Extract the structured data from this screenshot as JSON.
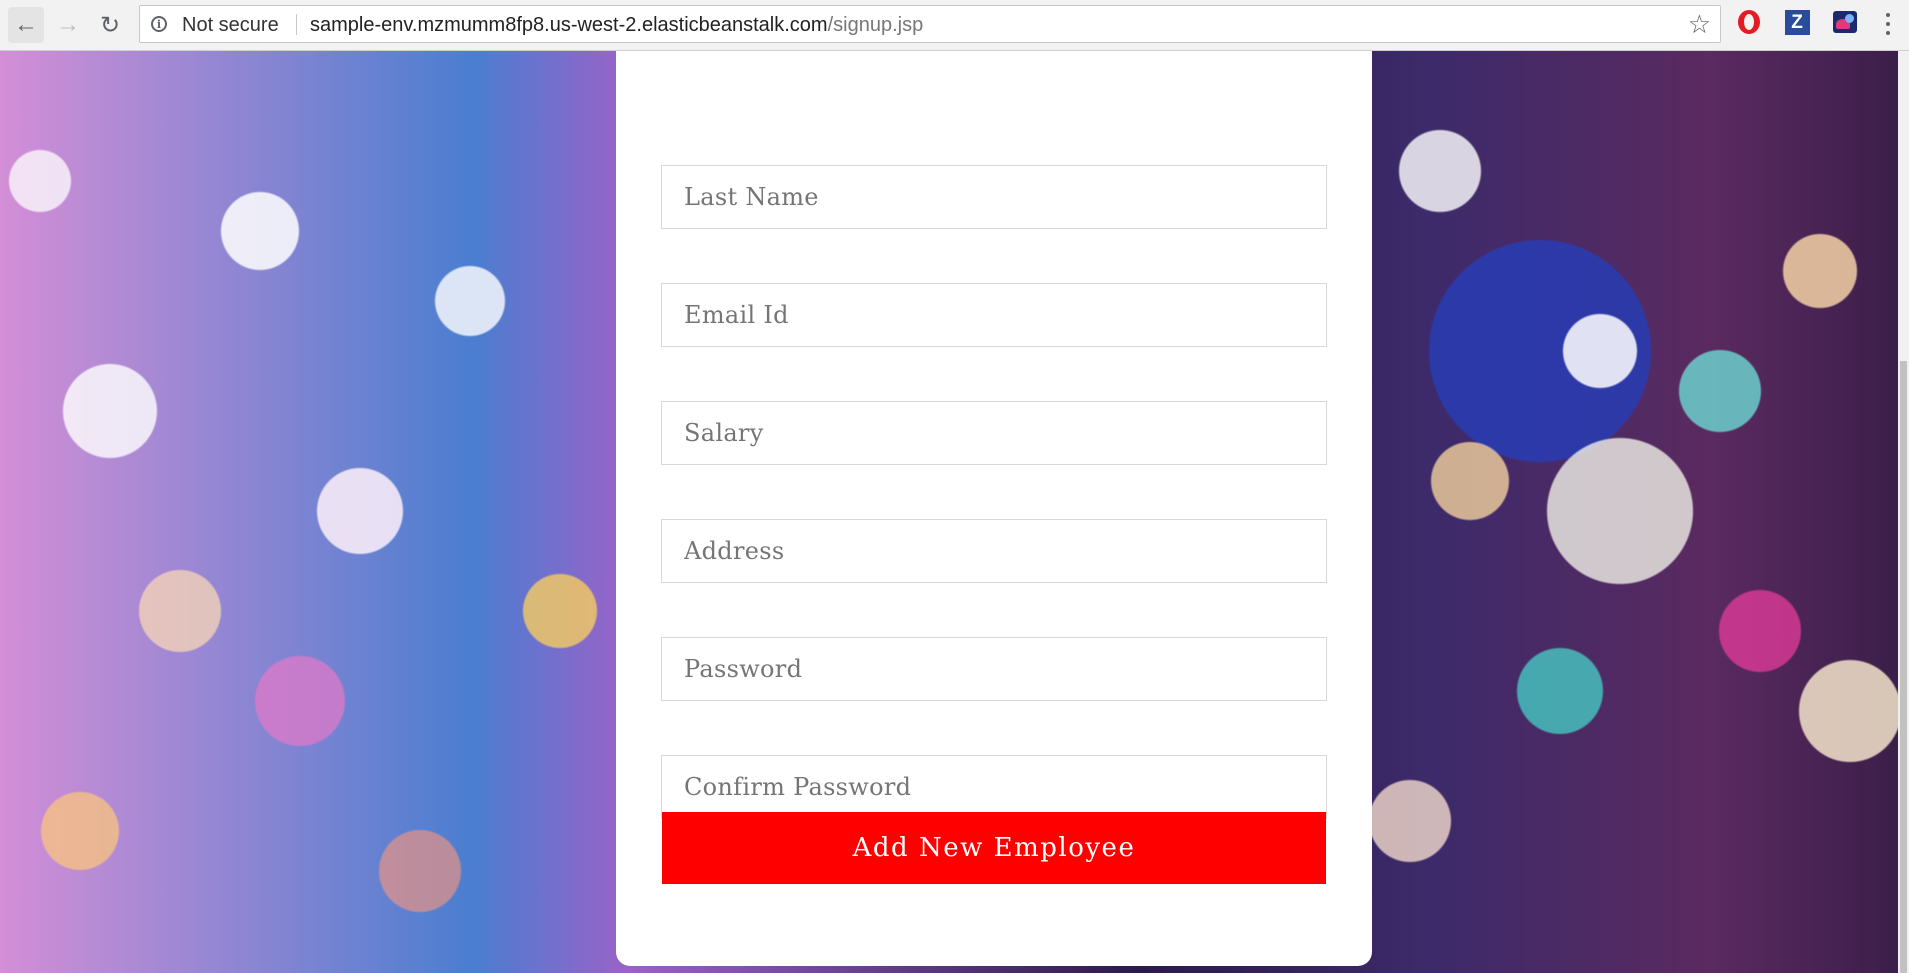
{
  "browser": {
    "security_label": "Not secure",
    "url_host": "sample-env.mzmumm8fp8.us-west-2.elasticbeanstalk.com",
    "url_path": "/signup.jsp",
    "extensions": [
      "opera-icon",
      "zotero-icon",
      "extension-icon"
    ]
  },
  "form": {
    "fields": {
      "last_name": {
        "placeholder": "Last Name",
        "value": ""
      },
      "email": {
        "placeholder": "Email Id",
        "value": ""
      },
      "salary": {
        "placeholder": "Salary",
        "value": ""
      },
      "address": {
        "placeholder": "Address",
        "value": ""
      },
      "password": {
        "placeholder": "Password",
        "value": ""
      },
      "confirm_password": {
        "placeholder": "Confirm Password",
        "value": ""
      }
    },
    "submit_label": "Add New Employee"
  },
  "colors": {
    "accent": "#ff0000",
    "card": "#ffffff",
    "chrome": "#f2f2f2"
  }
}
